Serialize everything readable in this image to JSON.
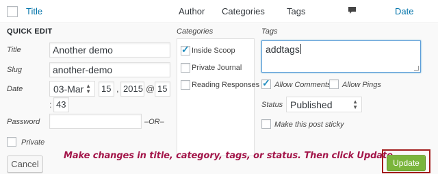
{
  "header": {
    "columns": {
      "title": "Title",
      "author": "Author",
      "categories": "Categories",
      "tags": "Tags",
      "comments_icon": "comment-bubble-icon",
      "date": "Date"
    }
  },
  "quick_edit": {
    "heading": "QUICK EDIT",
    "title_label": "Title",
    "title_value": "Another demo",
    "slug_label": "Slug",
    "slug_value": "another-demo",
    "date_label": "Date",
    "date": {
      "month": "03-Mar",
      "day": "15",
      "comma": ",",
      "year": "2015",
      "at": "@",
      "hour": "15",
      "colon": ":",
      "minute": "43"
    },
    "password_label": "Password",
    "password_value": "",
    "or_separator": "–OR–",
    "private_label": "Private",
    "private_checked": false
  },
  "categories": {
    "label": "Categories",
    "items": [
      {
        "label": "Inside Scoop",
        "checked": true
      },
      {
        "label": "Private Journal",
        "checked": false
      },
      {
        "label": "Reading Responses",
        "checked": false
      }
    ]
  },
  "tags": {
    "label": "Tags",
    "value": "addtags"
  },
  "options": {
    "allow_comments_label": "Allow Comments",
    "allow_comments": true,
    "allow_pings_label": "Allow Pings",
    "allow_pings": false,
    "status_label": "Status",
    "status_value": "Published",
    "sticky_label": "Make this post sticky",
    "sticky": false
  },
  "actions": {
    "cancel_label": "Cancel",
    "update_label": "Update"
  },
  "instruction": "Make changes in title, category, tags, or status. Then click Update.",
  "colors": {
    "link": "#0073aa",
    "update_button": "#7ab53c",
    "instruction_text": "#a3164a",
    "highlight_border": "#a21b1b"
  }
}
